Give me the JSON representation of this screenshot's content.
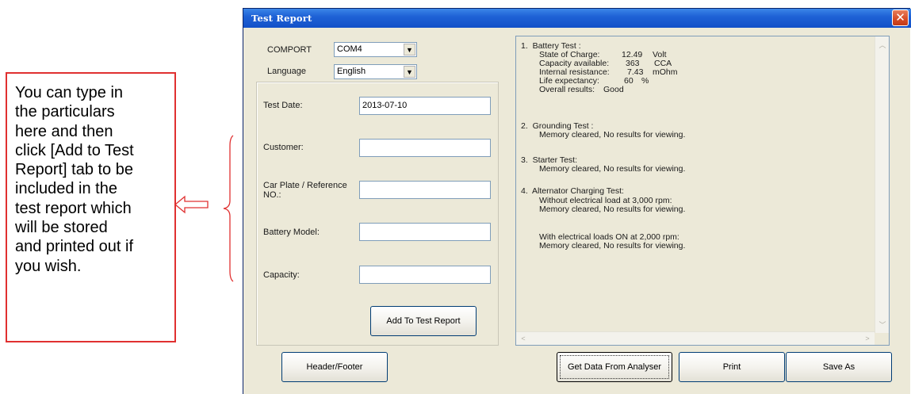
{
  "callout": {
    "lines": [
      "You can type in",
      "the particulars",
      "here and then",
      "click [Add to Test",
      "Report] tab to be",
      "included in the",
      "test report which",
      "will be stored",
      "and printed out if",
      "you wish."
    ]
  },
  "window": {
    "title": "Test Report",
    "close_glyph": "✕"
  },
  "settings": {
    "comport_label": "COMPORT",
    "comport_value": "COM4",
    "language_label": "Language",
    "language_value": "English"
  },
  "form": {
    "test_date_label": "Test Date:",
    "test_date_value": "2013-07-10",
    "customer_label": "Customer:",
    "customer_value": "",
    "car_plate_label_1": "Car Plate / Reference",
    "car_plate_label_2": "NO.:",
    "car_plate_value": "",
    "battery_model_label": "Battery Model:",
    "battery_model_value": "",
    "capacity_label": "Capacity:",
    "capacity_value": "",
    "add_button": "Add To Test Report"
  },
  "buttons": {
    "header_footer": "Header/Footer",
    "get_data": "Get Data From Analyser",
    "print": "Print",
    "save_as": "Save As"
  },
  "report": {
    "battery_title": "1.  Battery Test :",
    "soc_label": "State of Charge:",
    "soc_value": "12.49",
    "soc_unit": "Volt",
    "cap_label": "Capacity available:",
    "cap_value": "363",
    "cap_unit": "CCA",
    "ir_label": "Internal resistance:",
    "ir_value": "7.43",
    "ir_unit": "mOhm",
    "life_label": "Life expectancy:",
    "life_value": "60",
    "life_unit": "%",
    "overall_label": "Overall results:",
    "overall_value": "Good",
    "grounding_title": "2.  Grounding Test :",
    "grounding_msg": "Memory cleared, No results for viewing.",
    "starter_title": "3.  Starter Test:",
    "starter_msg": "Memory cleared, No results for viewing.",
    "alt_title": "4.  Alternator Charging Test:",
    "alt_sub1": "Without electrical load at 3,000 rpm:",
    "alt_msg1": "Memory cleared, No results for viewing.",
    "alt_sub2": "With electrical loads ON at 2,000 rpm:",
    "alt_msg2": "Memory cleared, No results for viewing."
  },
  "icons": {
    "dropdown": "dropdown-arrow-icon",
    "arrow_left": "hollow-arrow-left-icon",
    "close": "close-icon"
  },
  "colors": {
    "callout_border": "#e03030",
    "titlebar": "#1f62d6",
    "close_button": "#d64a25",
    "window_bg": "#ece9d8"
  }
}
